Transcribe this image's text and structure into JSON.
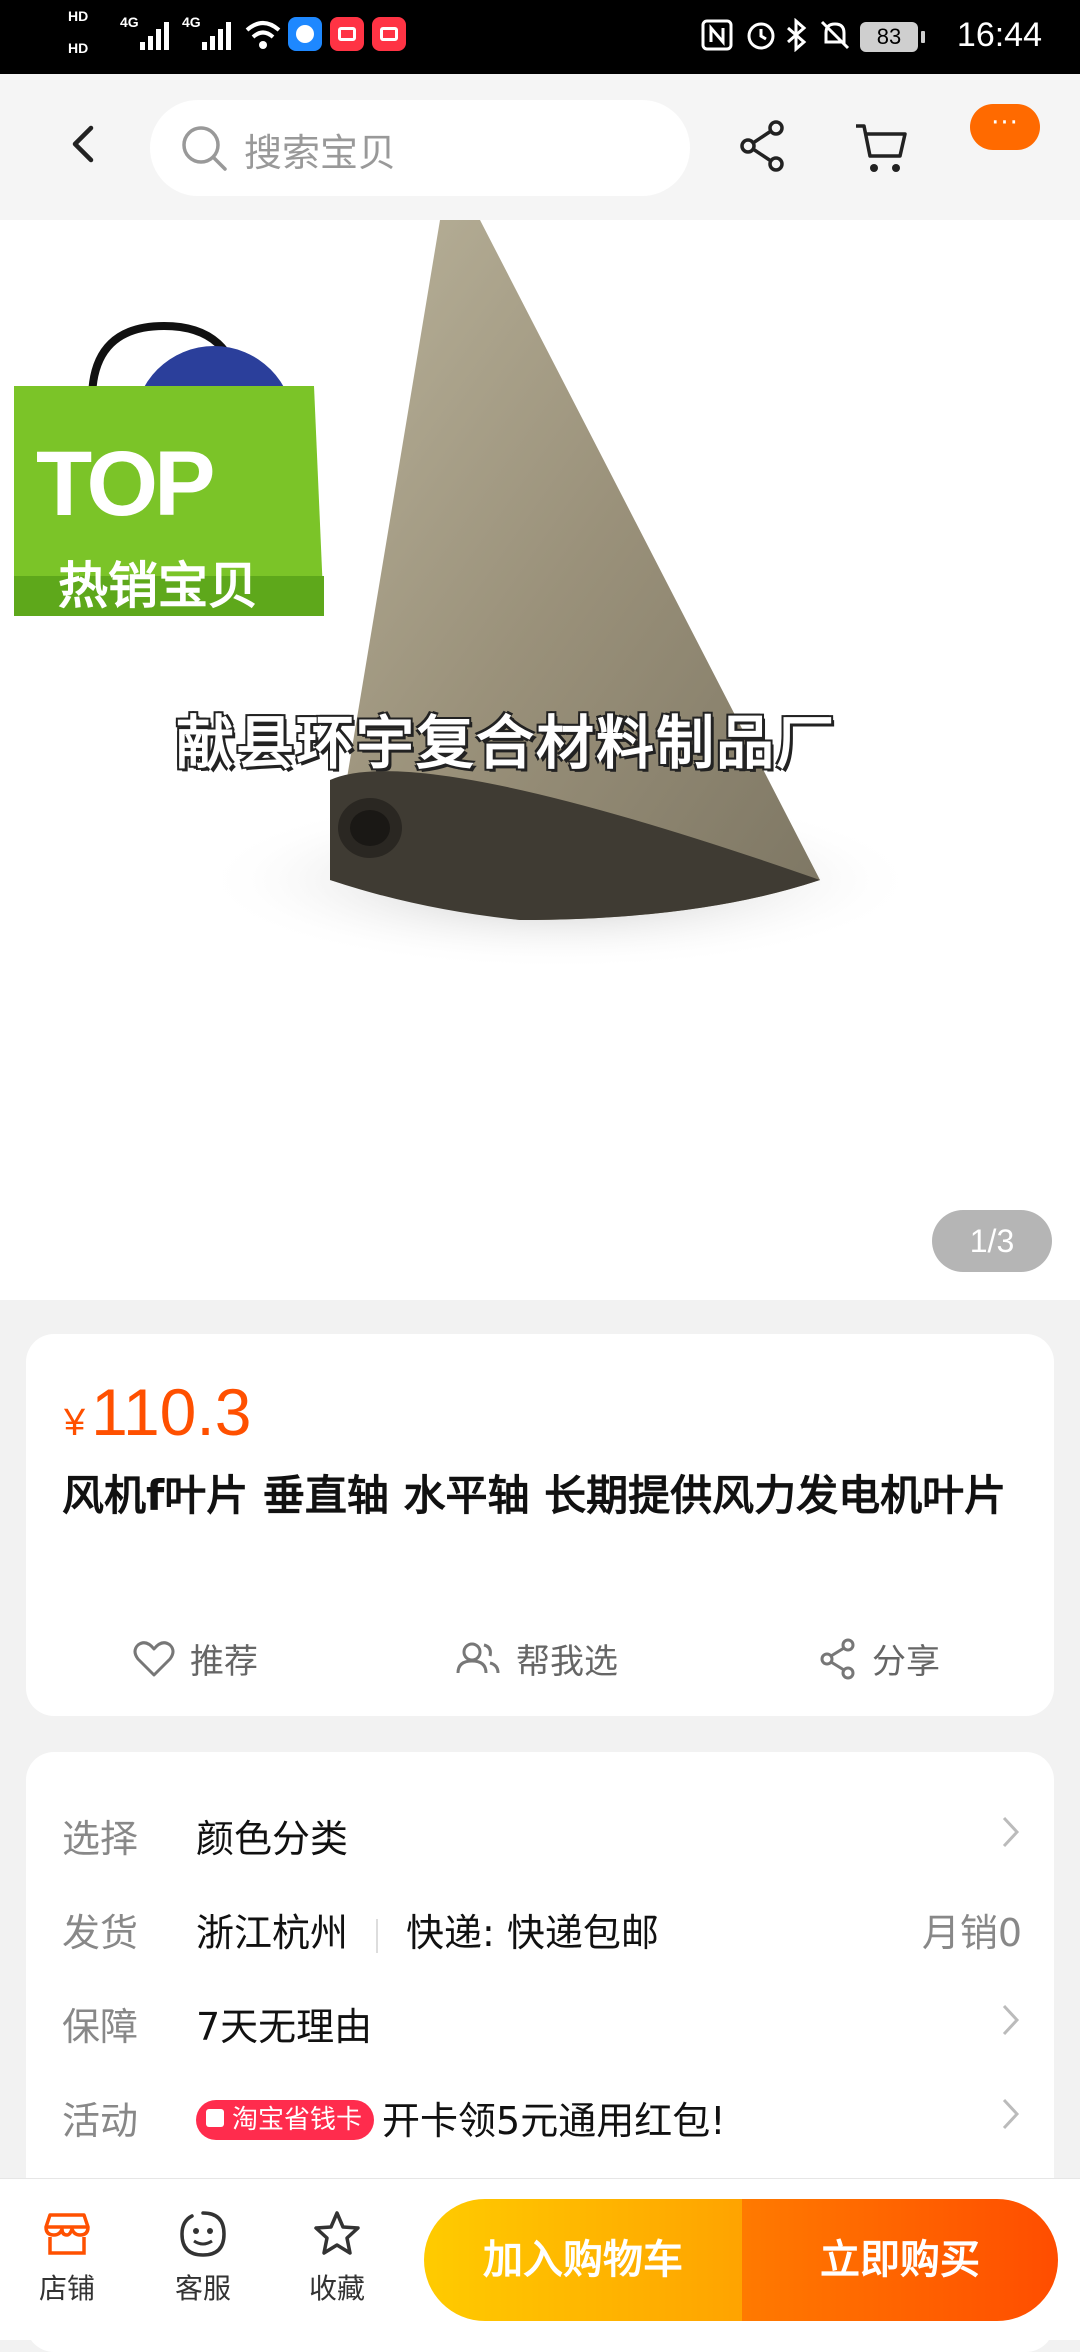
{
  "status_bar": {
    "time": "16:44",
    "battery": "83",
    "network_1": "4G",
    "network_2": "4G",
    "hd_1": "HD",
    "hd_2": "HD"
  },
  "header": {
    "search_placeholder": "搜索宝贝",
    "more_label": "···"
  },
  "gallery": {
    "badge_top": "TOP",
    "badge_sub": "热销宝贝",
    "watermark": "献县环宇复合材料制品厂",
    "page_indicator": "1/3"
  },
  "product": {
    "currency": "¥",
    "price": "110.3",
    "title": "风机f叶片 垂直轴 水平轴 长期提供风力发电机叶片",
    "actions": {
      "recommend": "推荐",
      "help_choose": "帮我选",
      "share": "分享"
    }
  },
  "info": {
    "select_label": "选择",
    "select_value": "颜色分类",
    "ship_label": "发货",
    "ship_from": "浙江杭州",
    "ship_method": "快递: 快递包邮",
    "monthly_sales": "月销0",
    "guarantee_label": "保障",
    "guarantee_value": "7天无理由",
    "activity_label": "活动",
    "activity_badge": "淘宝省钱卡",
    "activity_value": "开卡领5元通用红包!"
  },
  "bottom_bar": {
    "shop": "店铺",
    "service": "客服",
    "favorite": "收藏",
    "add_cart": "加入购物车",
    "buy_now": "立即购买"
  },
  "colors": {
    "accent": "#ff5000",
    "cart_button": "#ffb400",
    "buy_button": "#ff5a00"
  }
}
